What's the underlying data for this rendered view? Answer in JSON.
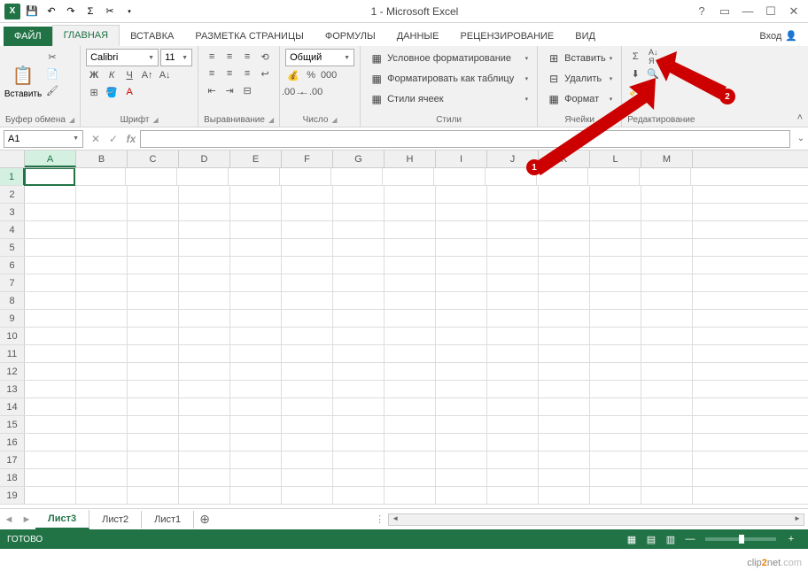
{
  "title": "1 - Microsoft Excel",
  "tabs": {
    "file": "ФАЙЛ",
    "home": "ГЛАВНАЯ",
    "insert": "ВСТАВКА",
    "layout": "РАЗМЕТКА СТРАНИЦЫ",
    "formulas": "ФОРМУЛЫ",
    "data": "ДАННЫЕ",
    "review": "РЕЦЕНЗИРОВАНИЕ",
    "view": "ВИД",
    "signin": "Вход"
  },
  "groups": {
    "clipboard": {
      "label": "Буфер обмена",
      "paste": "Вставить"
    },
    "font": {
      "label": "Шрифт",
      "name": "Calibri",
      "size": "11"
    },
    "align": {
      "label": "Выравнивание"
    },
    "number": {
      "label": "Число",
      "format": "Общий"
    },
    "styles": {
      "label": "Стили",
      "condfmt": "Условное форматирование",
      "formattable": "Форматировать как таблицу",
      "cellstyles": "Стили ячеек"
    },
    "cells": {
      "label": "Ячейки",
      "insert": "Вставить",
      "delete": "Удалить",
      "format": "Формат"
    },
    "editing": {
      "label": "Редактирование"
    }
  },
  "namebox": "A1",
  "columns": [
    "A",
    "B",
    "C",
    "D",
    "E",
    "F",
    "G",
    "H",
    "I",
    "J",
    "K",
    "L",
    "M"
  ],
  "rows": [
    "1",
    "2",
    "3",
    "4",
    "5",
    "6",
    "7",
    "8",
    "9",
    "10",
    "11",
    "12",
    "13",
    "14",
    "15",
    "16",
    "17",
    "18",
    "19"
  ],
  "sheets": {
    "s3": "Лист3",
    "s2": "Лист2",
    "s1": "Лист1"
  },
  "status": "ГОТОВО",
  "annotations": {
    "badge1": "1",
    "badge2": "2"
  },
  "watermark": {
    "a": "clip",
    "b": "2",
    "c": "net",
    "d": ".com"
  }
}
